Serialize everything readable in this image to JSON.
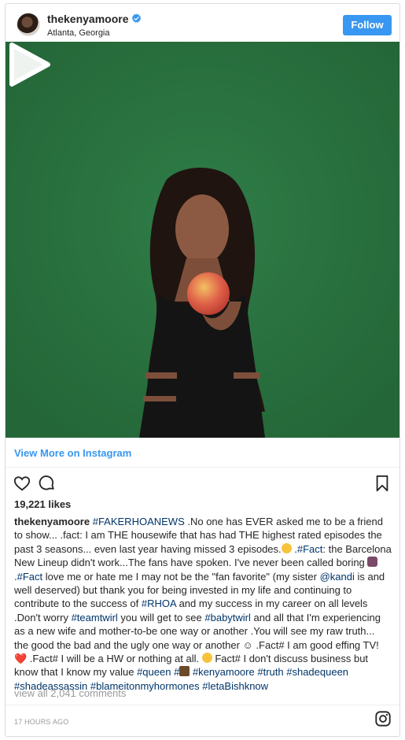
{
  "header": {
    "username": "thekenyamoore",
    "location": "Atlanta, Georgia",
    "follow_label": "Follow",
    "verified": true
  },
  "media": {
    "type": "video",
    "background_color": "#2a7240"
  },
  "view_more_label": "View More on Instagram",
  "likes": "19,221 likes",
  "caption": {
    "username": "thekenyamoore",
    "t1": "#FAKERHOANEWS",
    "t2": " .No one has EVER asked me to be a friend to show... .fact: I am THE housewife that has had THE highest rated episodes the past 3 seasons... even last year having missed 3 episodes.",
    "t3": " .",
    "t4": "#Fact",
    "t5": ": the Barcelona New Lineup didn't work...The fans have spoken. I've never been called boring ",
    "t6": " .",
    "t7": "#Fact",
    "t8": " love me or hate me I may not be the \"fan favorite\" (my sister ",
    "t9": "@kandi",
    "t10": " is and well deserved) but thank you for being invested in my life and continuing to contribute to the success of ",
    "t11": "#RHOA",
    "t12": " and my success in my career on all levels .Don't worry ",
    "t13": "#teamtwirl",
    "t14": " you will get to see ",
    "t15": "#babytwirl",
    "t16": " and all that I'm experiencing as a new wife and mother-to-be one way or another .You will see my raw truth... the good the bad and the ugly one way or another ☺ .Fact# I am good effing TV! ",
    "t17": "❤️",
    "t18": " .Fact# I will be a HW or nothing at all. ",
    "t19": " Fact# I don't discuss business but know that I know my value ",
    "t20": "#queen",
    "t21": " ",
    "t22": "#",
    "t23": " ",
    "t24": "#kenyamoore",
    "t25": " ",
    "t26": "#truth",
    "t27": " ",
    "t28": "#shadequeen",
    "t29": " ",
    "t30": "#shadeassassin",
    "t31": " ",
    "t32": "#blameitonmyhormones",
    "t33": " ",
    "t34": "#letaBishknow"
  },
  "view_all_comments": "view all 2,041 comments",
  "timestamp": "17 HOURS AGO",
  "colors": {
    "accent": "#3897f0",
    "hashtag": "#003569",
    "muted": "#999999"
  },
  "icons": {
    "like": "heart-icon",
    "comment": "comment-icon",
    "save": "bookmark-icon",
    "brand": "instagram-icon",
    "play": "play-icon"
  }
}
